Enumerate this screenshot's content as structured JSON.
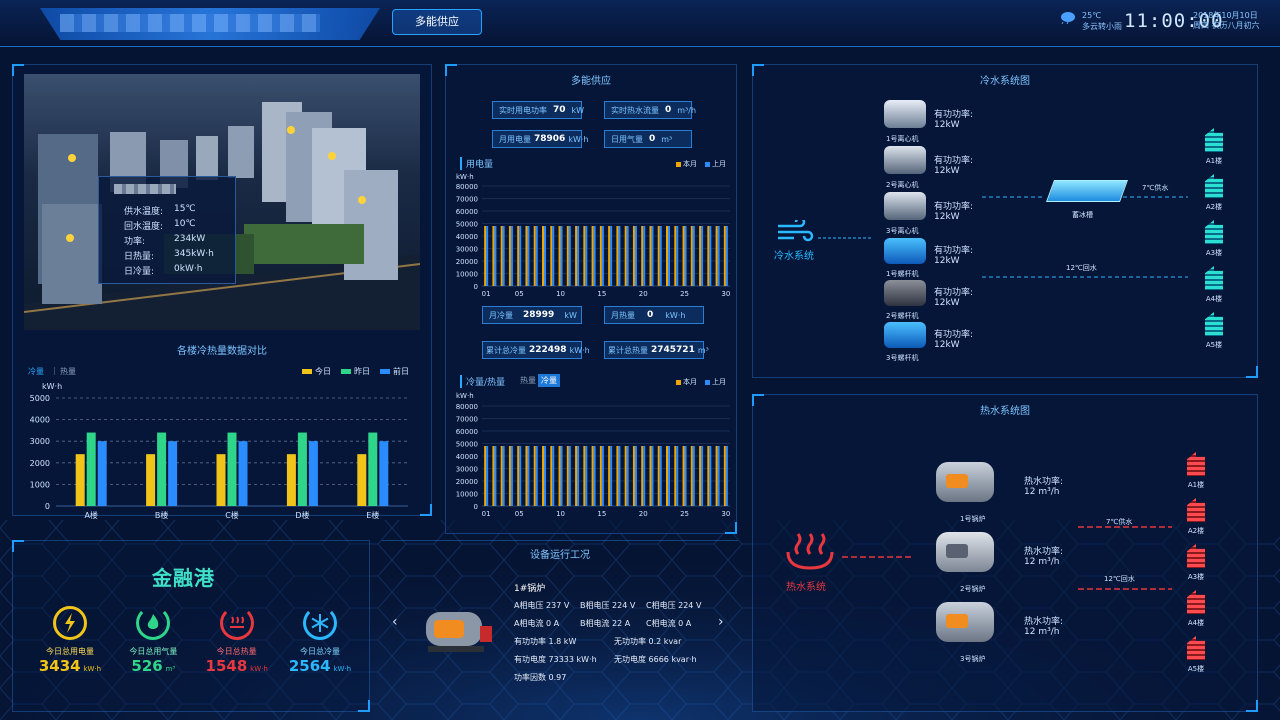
{
  "header": {
    "active_tab": "多能供应",
    "weather_temp": "25℃",
    "weather_desc": "多云转小雨",
    "time": "11:00:00",
    "date": "2018年10月10日",
    "weekday_lunar": "周四 农历八月初六"
  },
  "photo_panel": {
    "info_rows": [
      {
        "label": "供水温度:",
        "value": "15℃"
      },
      {
        "label": "回水温度:",
        "value": "10℃"
      },
      {
        "label": "功率:",
        "value": "234kW"
      },
      {
        "label": "日热量:",
        "value": "345kW·h"
      },
      {
        "label": "日冷量:",
        "value": "0kW·h"
      }
    ]
  },
  "compare_panel": {
    "title": "各楼冷热量数据对比",
    "tab_active": "冷量",
    "tab_inactive": "热量",
    "unit": "kW·h",
    "legend": [
      {
        "name": "今日",
        "color": "#f0c419"
      },
      {
        "name": "昨日",
        "color": "#2fd68a"
      },
      {
        "name": "前日",
        "color": "#2a8cff"
      }
    ]
  },
  "center_panel": {
    "title": "多能供应",
    "stats_top": [
      {
        "label": "实时用电功率",
        "value": "70",
        "unit": "kW"
      },
      {
        "label": "实时热水流量",
        "value": "0",
        "unit": "m³/h"
      },
      {
        "label": "月用电量",
        "value": "78906",
        "unit": "kW·h"
      },
      {
        "label": "日用气量",
        "value": "0",
        "unit": "m³"
      }
    ],
    "stats_mid": [
      {
        "label": "月冷量",
        "value": "28999",
        "unit": "kW"
      },
      {
        "label": "月热量",
        "value": "0",
        "unit": "kW·h"
      },
      {
        "label": "累计总冷量",
        "value": "222498",
        "unit": "kW·h"
      },
      {
        "label": "累计总热量",
        "value": "2745721",
        "unit": "m³"
      }
    ],
    "chart1_title": "用电量",
    "chart2_title": "冷量/热量",
    "chart2_tab_a": "热量",
    "chart2_tab_b": "冷量",
    "legend_a": "本月",
    "legend_b": "上月",
    "unit": "kW·h"
  },
  "summary": {
    "brand": "金融港",
    "kpis": [
      {
        "label": "今日总用电量",
        "value": "3434",
        "unit": "kW·h",
        "color": "#f0c419",
        "icon": "lightning-icon"
      },
      {
        "label": "今日总用气量",
        "value": "526",
        "unit": "m³",
        "color": "#2fd68a",
        "icon": "flame-icon"
      },
      {
        "label": "今日总热量",
        "value": "1548",
        "unit": "kW·h",
        "color": "#e8373e",
        "icon": "heat-icon"
      },
      {
        "label": "今日总冷量",
        "value": "2564",
        "unit": "kW·h",
        "color": "#2ab8ff",
        "icon": "snowflake-icon"
      }
    ]
  },
  "equipment": {
    "title": "设备运行工况",
    "name": "1#锅炉",
    "rows": [
      [
        "A相电压 237 V",
        "B相电压 224 V",
        "C相电压 224 V"
      ],
      [
        "A相电流  0   A",
        "B相电流  22  A",
        "C相电流  0   A"
      ],
      [
        "有功功率 1.8 kW",
        "无功功率 0.2 kvar",
        ""
      ],
      [
        "有功电度 73333 kW·h",
        "无功电度 6666 kvar·h",
        ""
      ],
      [
        "功率因数 0.97",
        "",
        ""
      ]
    ]
  },
  "cold_system": {
    "title": "冷水系统图",
    "system_label": "冷水系统",
    "machines": [
      {
        "name": "1号离心机",
        "label": "有功功率:",
        "value": "12kW"
      },
      {
        "name": "2号离心机",
        "label": "有功功率:",
        "value": "12kW"
      },
      {
        "name": "3号离心机",
        "label": "有功功率:",
        "value": "12kW"
      },
      {
        "name": "1号螺杆机",
        "label": "有功功率:",
        "value": "12kW"
      },
      {
        "name": "2号螺杆机",
        "label": "有功功率:",
        "value": "12kW"
      },
      {
        "name": "3号螺杆机",
        "label": "有功功率:",
        "value": "12kW"
      }
    ],
    "tank_label": "蓄冰槽",
    "supply_label": "7℃供水",
    "return_label": "12℃回水",
    "buildings": [
      "A1楼",
      "A2楼",
      "A3楼",
      "A4楼",
      "A5楼"
    ]
  },
  "hot_system": {
    "title": "热水系统图",
    "system_label": "热水系统",
    "boilers": [
      {
        "name": "1号锅炉",
        "label": "热水功率:",
        "value": "12 m³/h"
      },
      {
        "name": "2号锅炉",
        "label": "热水功率:",
        "value": "12 m³/h"
      },
      {
        "name": "3号锅炉",
        "label": "热水功率:",
        "value": "12 m³/h"
      }
    ],
    "supply_label": "7℃供水",
    "return_label": "12℃回水",
    "buildings": [
      "A1楼",
      "A2楼",
      "A3楼",
      "A4楼",
      "A5楼"
    ]
  },
  "chart_data": [
    {
      "type": "bar",
      "title": "各楼冷热量数据对比",
      "ylabel": "kW·h",
      "categories": [
        "A楼",
        "B楼",
        "C楼",
        "D楼",
        "E楼"
      ],
      "ylim": [
        0,
        5000
      ],
      "yticks": [
        0,
        1000,
        2000,
        3000,
        4000,
        5000
      ],
      "series": [
        {
          "name": "今日",
          "color": "#f0c419",
          "values": [
            2400,
            2400,
            2400,
            2400,
            2400
          ]
        },
        {
          "name": "昨日",
          "color": "#2fd68a",
          "values": [
            3400,
            3400,
            3400,
            3400,
            3400
          ]
        },
        {
          "name": "前日",
          "color": "#2a8cff",
          "values": [
            3000,
            3000,
            3000,
            3000,
            3000
          ]
        }
      ]
    },
    {
      "type": "bar",
      "title": "用电量",
      "ylabel": "kW·h",
      "ylim": [
        0,
        80000
      ],
      "yticks": [
        0,
        10000,
        20000,
        30000,
        40000,
        50000,
        60000,
        70000,
        80000
      ],
      "xticks": [
        "01",
        "05",
        "10",
        "15",
        "20",
        "25",
        "30"
      ],
      "days": 30,
      "series": [
        {
          "name": "本月",
          "color": "#f0a500",
          "value": 48000
        },
        {
          "name": "上月",
          "color": "#2a8cff",
          "value": 48000
        }
      ]
    },
    {
      "type": "bar",
      "title": "冷量/热量",
      "ylabel": "kW·h",
      "ylim": [
        0,
        80000
      ],
      "yticks": [
        0,
        10000,
        20000,
        30000,
        40000,
        50000,
        60000,
        70000,
        80000
      ],
      "xticks": [
        "01",
        "05",
        "10",
        "15",
        "20",
        "25",
        "30"
      ],
      "days": 30,
      "series": [
        {
          "name": "本月",
          "color": "#f0a500",
          "value": 48000
        },
        {
          "name": "上月",
          "color": "#2a8cff",
          "value": 48000
        }
      ]
    }
  ]
}
